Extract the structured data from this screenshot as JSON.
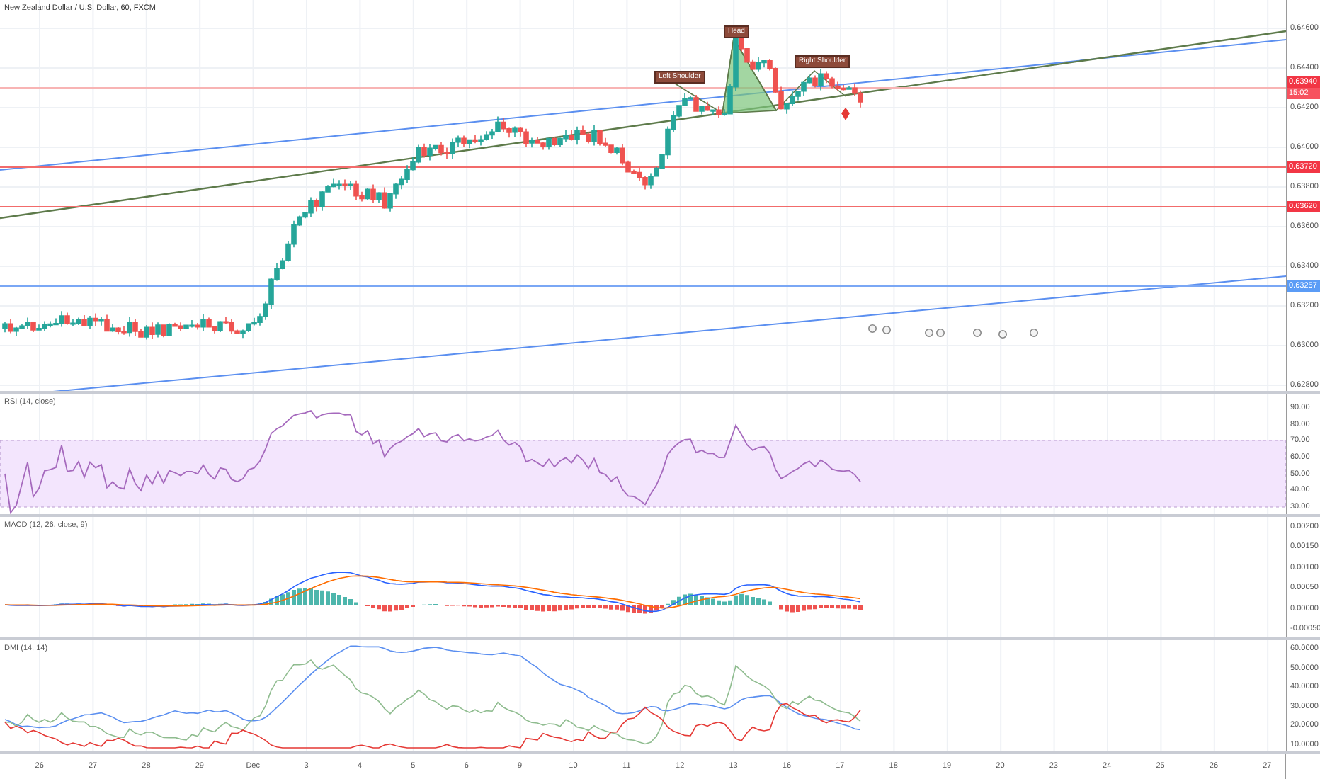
{
  "main": {
    "title": "New Zealand Dollar / U.S. Dollar, 60, FXCM",
    "price_axis": [
      "0.64600",
      "0.64400",
      "0.64200",
      "0.64000",
      "0.63800",
      "0.63600",
      "0.63400",
      "0.63200",
      "0.63000",
      "0.62800"
    ],
    "price_tags": [
      {
        "text": "0.63940",
        "color": "#f23645"
      },
      {
        "text": "15:02",
        "color": "#f7525f"
      },
      {
        "text": "0.63720",
        "color": "#f23645"
      },
      {
        "text": "0.63620",
        "color": "#f23645"
      },
      {
        "text": "0.63257",
        "color": "#5b9cf6"
      }
    ],
    "pattern_labels": [
      "Left Shoulder",
      "Head",
      "Right Shoulder"
    ]
  },
  "rsi": {
    "title": "RSI (14, close)",
    "axis": [
      "90.00",
      "80.00",
      "70.00",
      "60.00",
      "50.00",
      "40.00",
      "30.00"
    ]
  },
  "macd": {
    "title": "MACD (12, 26, close, 9)",
    "axis": [
      "0.00200",
      "0.00150",
      "0.00100",
      "0.00050",
      "0.00000",
      "-0.00050"
    ]
  },
  "dmi": {
    "title": "DMI (14, 14)",
    "axis": [
      "60.0000",
      "50.0000",
      "40.0000",
      "30.0000",
      "20.0000",
      "10.0000"
    ]
  },
  "time_axis": [
    "26",
    "27",
    "28",
    "29",
    "Dec",
    "3",
    "4",
    "5",
    "6",
    "9",
    "10",
    "11",
    "12",
    "13",
    "16",
    "17",
    "18",
    "19",
    "20",
    "23",
    "24",
    "25",
    "26",
    "27"
  ]
}
